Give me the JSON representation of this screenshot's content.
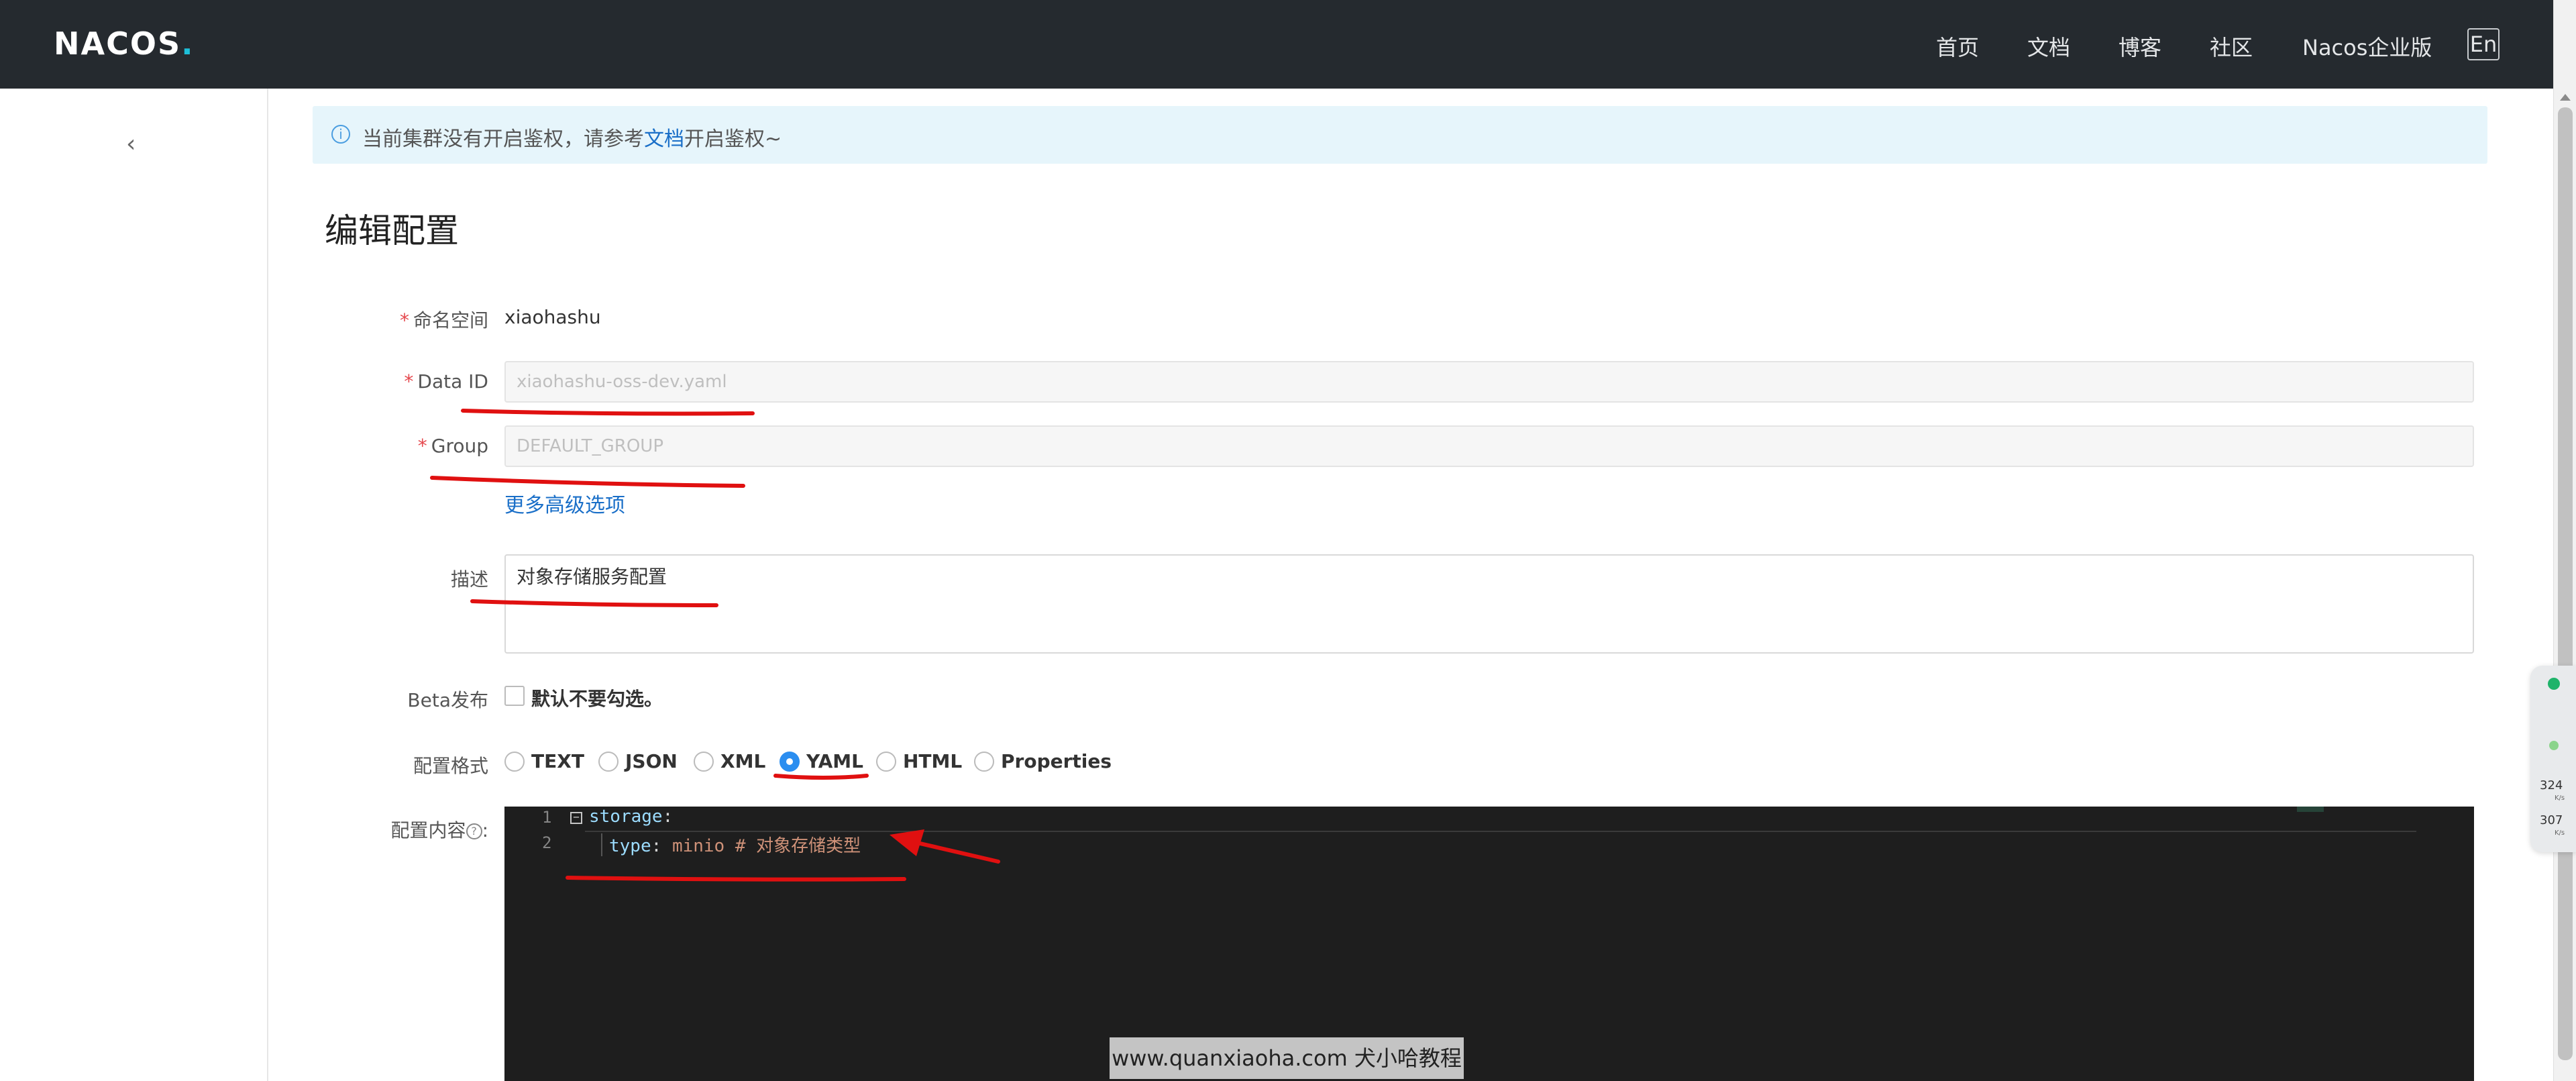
{
  "nav": {
    "logo_text": "NACOS",
    "logo_dot": ".",
    "items": [
      "首页",
      "文档",
      "博客",
      "社区",
      "Nacos企业版"
    ],
    "lang": "En"
  },
  "sidebar": {
    "collapse_icon": "chevron-left-icon",
    "collapse_glyph": "‹"
  },
  "banner": {
    "text_before": "当前集群没有开启鉴权，请参考",
    "link": "文档",
    "text_after": "开启鉴权~"
  },
  "page_title": "编辑配置",
  "form": {
    "namespace": {
      "label": "命名空间",
      "value": "xiaohashu"
    },
    "data_id": {
      "label": "Data ID",
      "value": "xiaohashu-oss-dev.yaml"
    },
    "group": {
      "label": "Group",
      "value": "DEFAULT_GROUP"
    },
    "advanced_link": "更多高级选项",
    "description": {
      "label": "描述",
      "value": "对象存储服务配置"
    },
    "beta": {
      "label": "Beta发布",
      "checkbox_label": "默认不要勾选。",
      "checked": false
    },
    "format": {
      "label": "配置格式",
      "options": [
        "TEXT",
        "JSON",
        "XML",
        "YAML",
        "HTML",
        "Properties"
      ],
      "selected": "YAML"
    },
    "content": {
      "label": "配置内容",
      "help_glyph": "?",
      "colon": ":"
    }
  },
  "editor": {
    "lines": [
      {
        "num": "1",
        "key": "storage",
        "punc": ":",
        "value": "",
        "comment": ""
      },
      {
        "num": "2",
        "key": "type",
        "punc": ": ",
        "value": "minio",
        "comment": " # 对象存储类型"
      }
    ]
  },
  "float_widget": {
    "upload": "324",
    "download": "307",
    "unit": "K/s"
  },
  "watermark": "www.quanxiaoha.com 犬小哈教程",
  "colors": {
    "nav_bg": "#252a2f",
    "accent": "#2b8ef0",
    "link": "#1a6fc8",
    "required": "#e5484d",
    "annotation": "#e01010"
  }
}
